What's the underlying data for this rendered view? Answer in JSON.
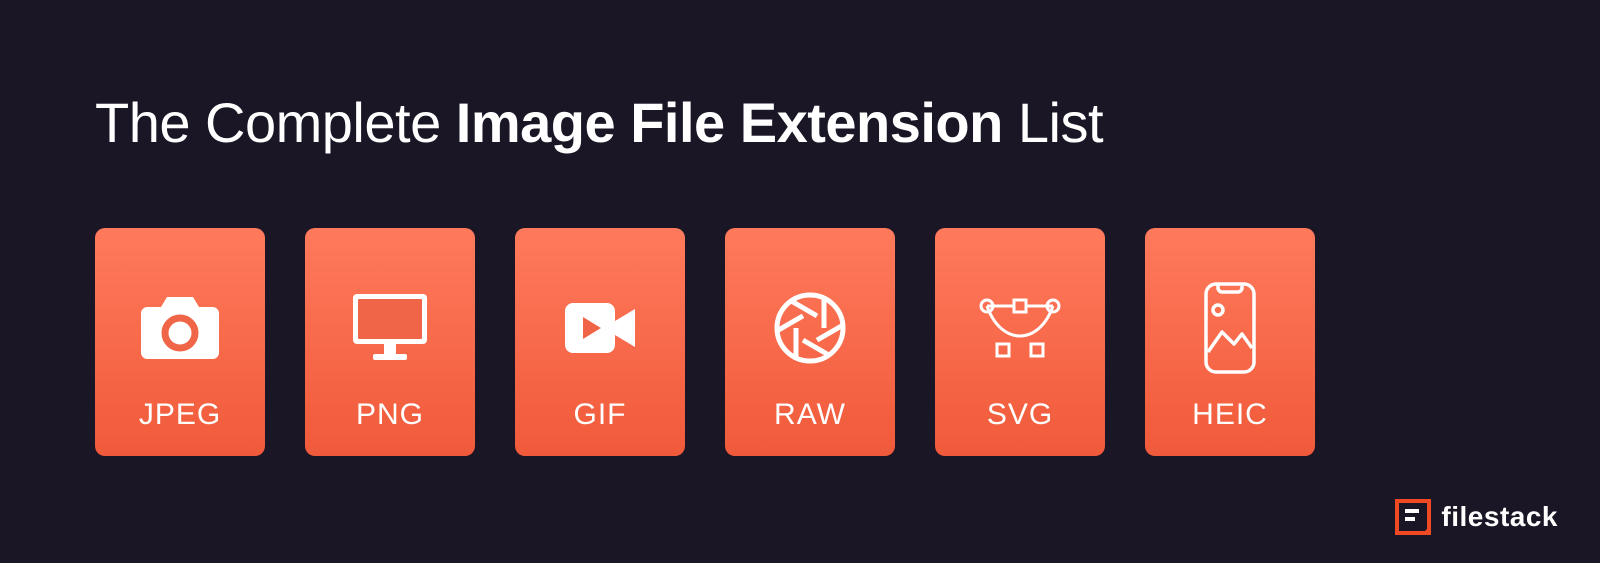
{
  "title": {
    "prefix": "The Complete ",
    "bold": "Image File Extension",
    "suffix": " List"
  },
  "cards": [
    {
      "label": "JPEG",
      "icon": "camera-icon"
    },
    {
      "label": "PNG",
      "icon": "monitor-icon"
    },
    {
      "label": "GIF",
      "icon": "video-icon"
    },
    {
      "label": "RAW",
      "icon": "aperture-icon"
    },
    {
      "label": "SVG",
      "icon": "vector-icon"
    },
    {
      "label": "HEIC",
      "icon": "phone-image-icon"
    }
  ],
  "brand": {
    "name": "filestack"
  },
  "colors": {
    "background": "#1a1625",
    "card_top": "#ff7a5c",
    "card_bottom": "#f05a3a",
    "brand_accent": "#ef4a23",
    "text": "#ffffff"
  }
}
